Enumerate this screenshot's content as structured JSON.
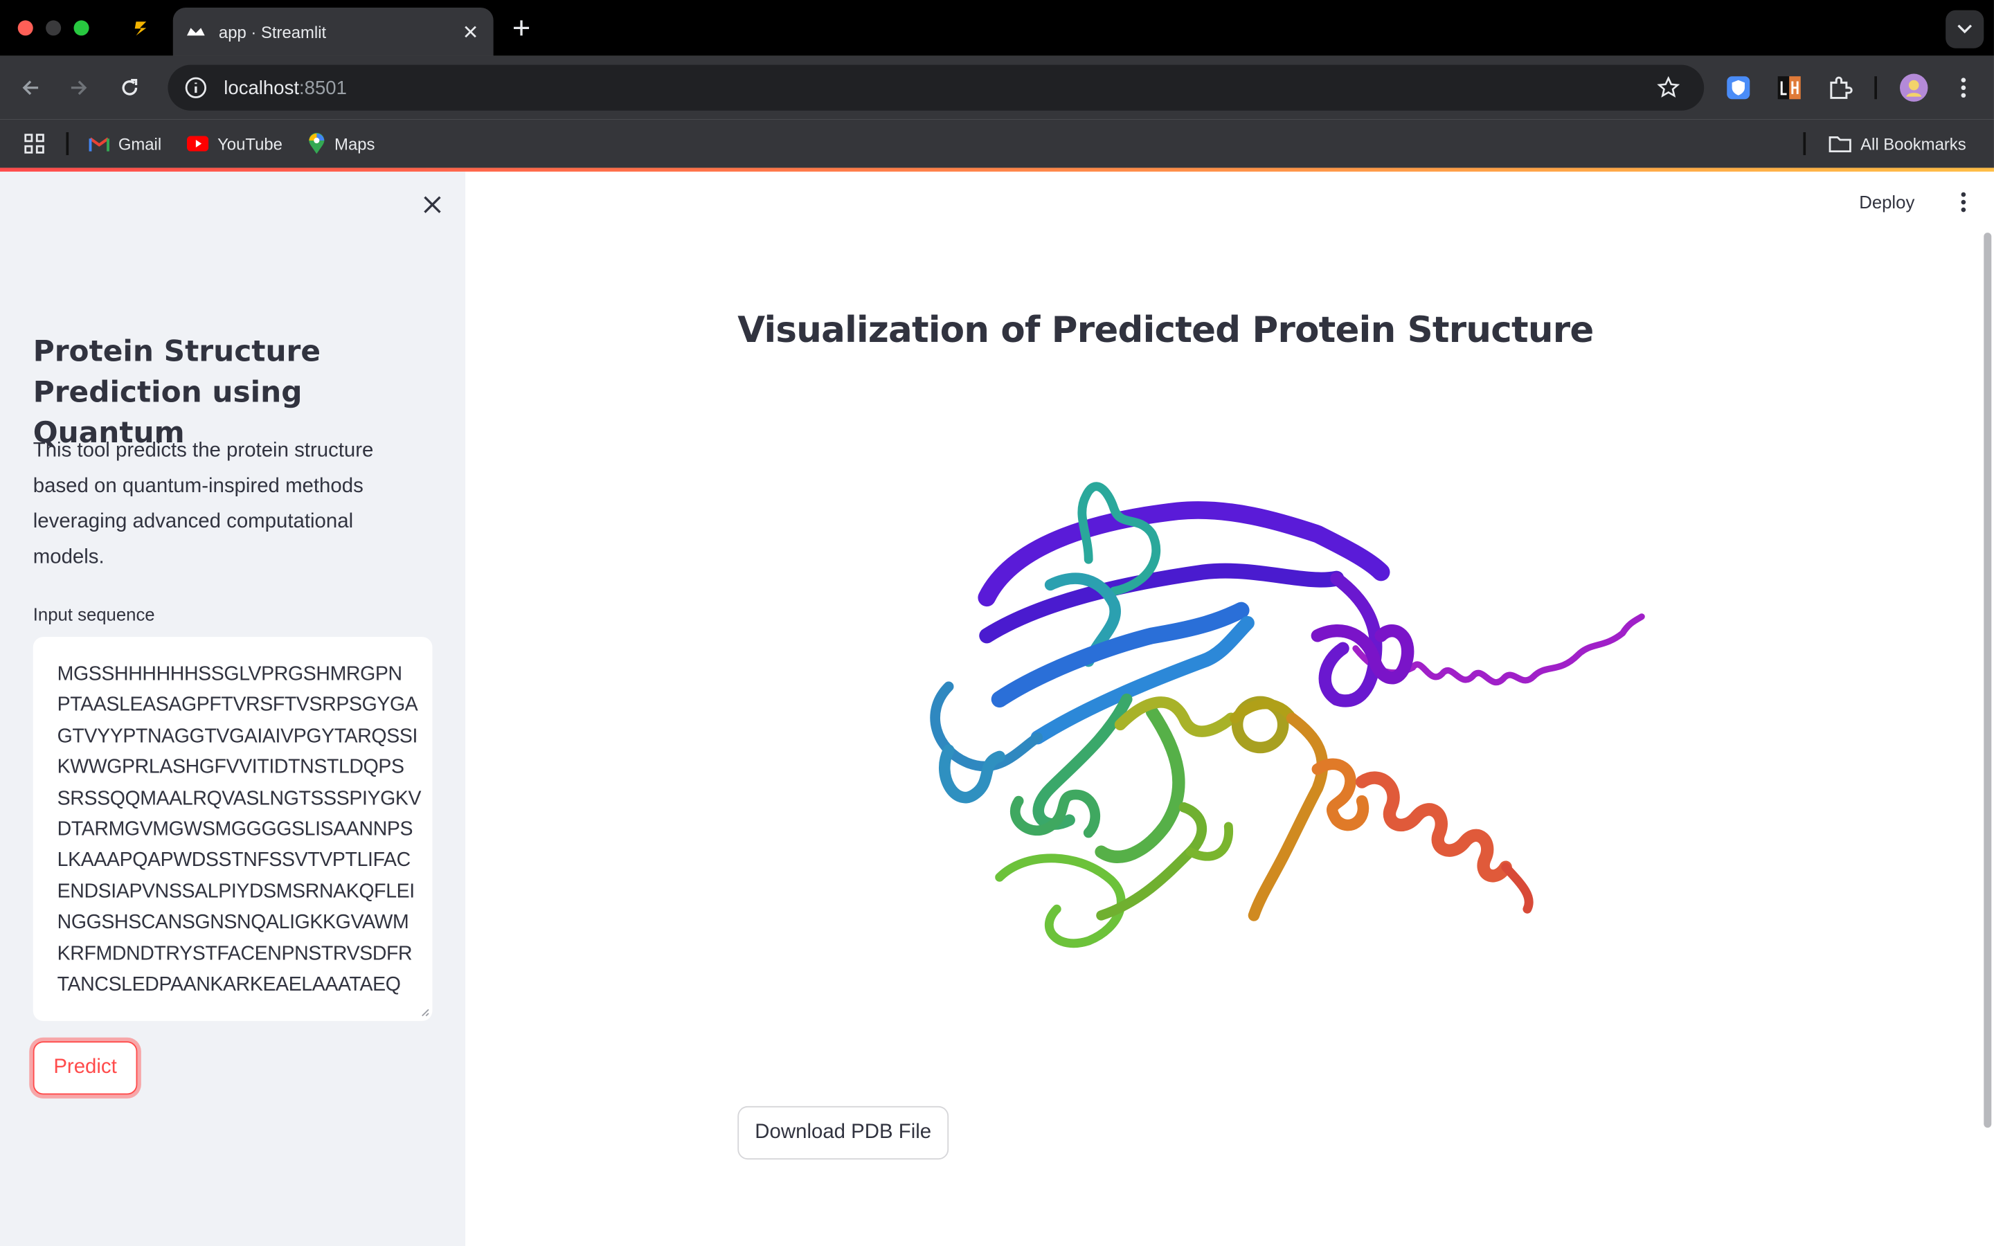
{
  "browser": {
    "tab_title": "app · Streamlit",
    "url_host": "localhost",
    "url_port": ":8501",
    "bookmarks": [
      {
        "label": "Gmail"
      },
      {
        "label": "YouTube"
      },
      {
        "label": "Maps"
      }
    ],
    "all_bookmarks": "All Bookmarks"
  },
  "sidebar": {
    "title": "Protein Structure Prediction using Quantum",
    "description": "This tool predicts the protein structure based on quantum-inspired methods leveraging advanced computational models.",
    "input_label": "Input sequence",
    "input_value": "MGSSHHHHHHSSGLVPRGSHMRGPN\nPTAASLEASAGPFTVRSFTVSRPSGYGA\nGTVYYPTNAGGTVGAIAIVPGYTARQSSI\nKWWGPRLASHGFVVITIDTNSTLDQPS\nSRSSQQMAALRQVASLNGTSSSPIYGKV\nDTARMGVMGWSMGGGGSLISAANNPS\nLKAAAPQAPWDSSTNFSSVTVPTLIFAC\nENDSIAPVNSSALPIYDSMSRNAKQFLEI\nNGGSHSCANSGNSNQALIGKKGVAWM\nKRFMDNDTRYSTFACENPNSTRVSDFR\nTANCSLEDPAANKARKEAELAAATAEQ",
    "predict_label": "Predict"
  },
  "header": {
    "deploy_label": "Deploy"
  },
  "main": {
    "title": "Visualization of Predicted Protein Structure",
    "download_label": "Download PDB File"
  },
  "colors": {
    "accent": "#ff4b4b",
    "text": "#31333f",
    "sidebar_bg": "#f0f2f6"
  }
}
